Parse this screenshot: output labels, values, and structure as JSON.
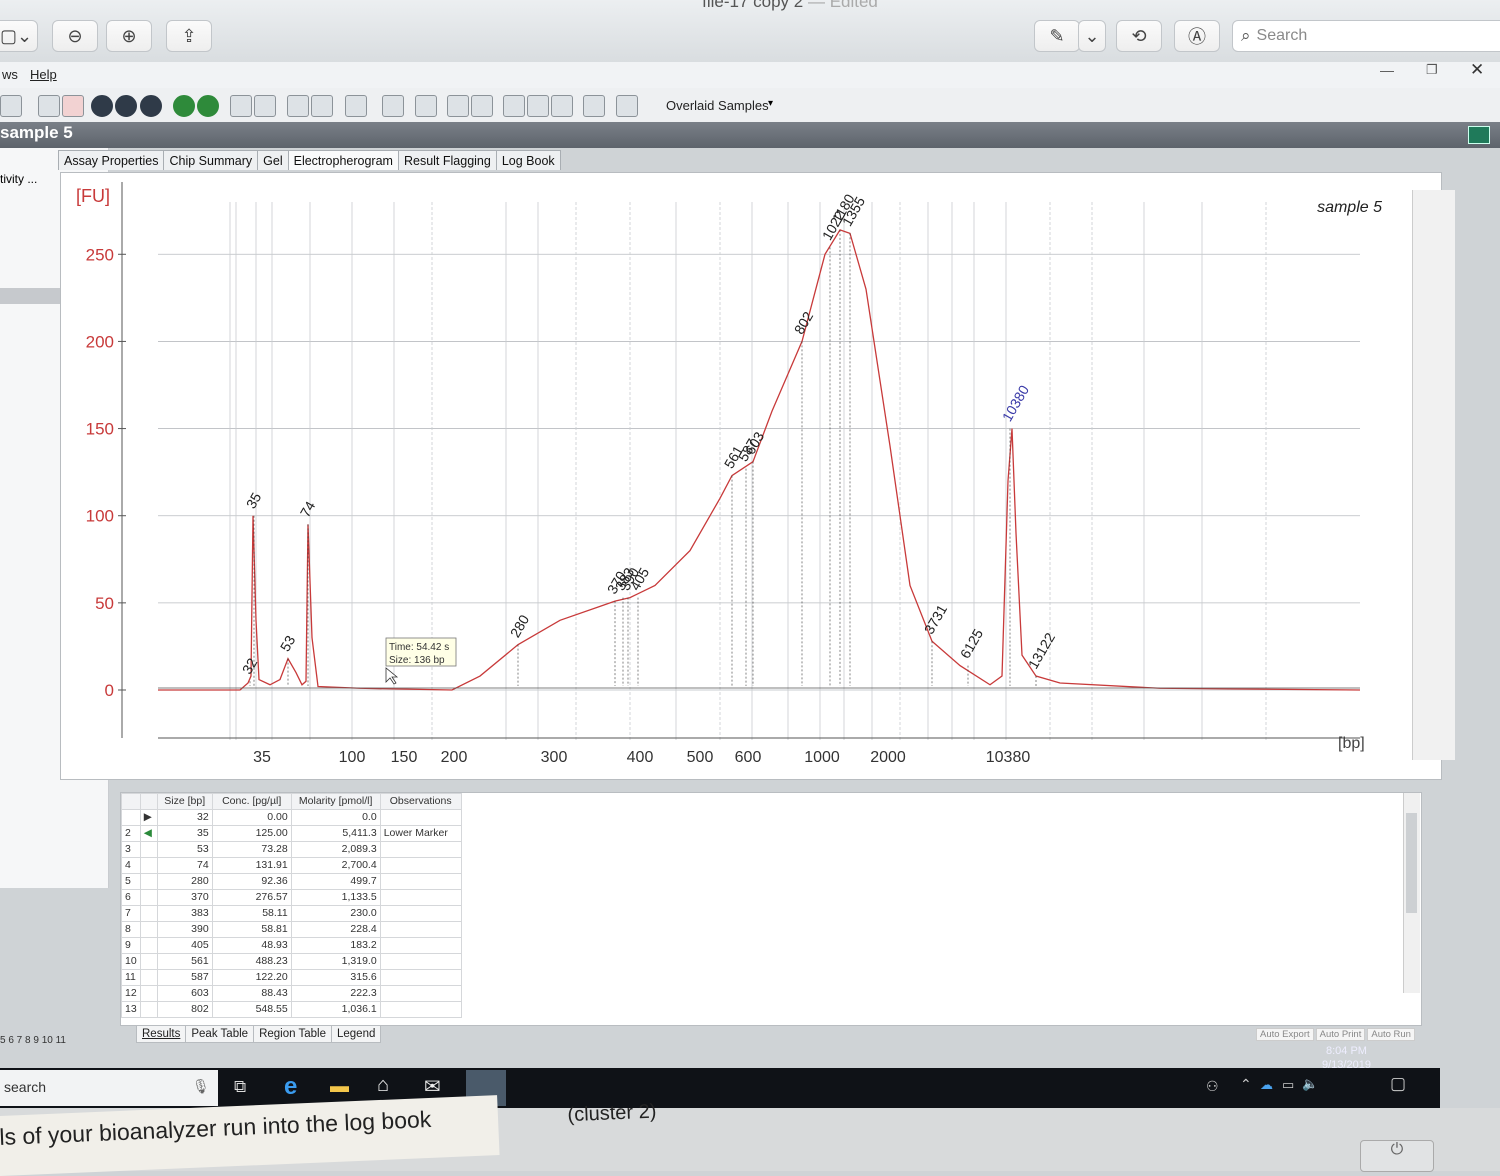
{
  "mac": {
    "title": "file-17 copy 2",
    "title_sep": " — ",
    "edited": "Edited",
    "search_placeholder": "Search"
  },
  "menu": {
    "items": [
      "ws",
      "Help"
    ]
  },
  "toolbar": {
    "overlaid_label": "Overlaid Samples"
  },
  "sample_bar": {
    "title": "sample 5"
  },
  "left_panel": {
    "label": "tivity ...",
    "pages": "5  6  7  8  9  10  11"
  },
  "tabs": [
    "Assay Properties",
    "Chip Summary",
    "Gel",
    "Electropherogram",
    "Result Flagging",
    "Log Book"
  ],
  "chart_data": {
    "type": "line",
    "title": "sample 5",
    "ylabel": "[FU]",
    "xlabel": "[bp]",
    "ylim": [
      0,
      280
    ],
    "x_ticks": [
      "35",
      "100",
      "150",
      "200",
      "300",
      "400",
      "500",
      "600",
      "1000",
      "2000",
      "10380"
    ],
    "y_ticks": [
      0,
      50,
      100,
      150,
      200,
      250
    ],
    "peak_labels": [
      "32",
      "35",
      "53",
      "74",
      "280",
      "370",
      "383",
      "390",
      "405",
      "561",
      "587",
      "603",
      "802",
      "1022",
      "1180",
      "1355",
      "3731",
      "6125",
      "10380",
      "13122"
    ],
    "peak_heights": [
      5,
      100,
      18,
      95,
      26,
      51,
      53,
      53,
      53,
      123,
      127,
      131,
      200,
      254,
      264,
      262,
      28,
      14,
      150,
      8
    ],
    "tooltip": {
      "time": "Time: 54.42 s",
      "size": "Size: 136 bp"
    },
    "grid": true,
    "series_color": "#c83a3a",
    "marker_label_color": "#3a3aa8"
  },
  "table": {
    "headers": [
      "Size [bp]",
      "Conc. [pg/µl]",
      "Molarity [pmol/l]",
      "Observations"
    ],
    "rows": [
      {
        "idx": "",
        "size": "32",
        "conc": "0.00",
        "mol": "0.0",
        "obs": ""
      },
      {
        "idx": "2",
        "size": "35",
        "conc": "125.00",
        "mol": "5,411.3",
        "obs": "Lower Marker"
      },
      {
        "idx": "3",
        "size": "53",
        "conc": "73.28",
        "mol": "2,089.3",
        "obs": ""
      },
      {
        "idx": "4",
        "size": "74",
        "conc": "131.91",
        "mol": "2,700.4",
        "obs": ""
      },
      {
        "idx": "5",
        "size": "280",
        "conc": "92.36",
        "mol": "499.7",
        "obs": ""
      },
      {
        "idx": "6",
        "size": "370",
        "conc": "276.57",
        "mol": "1,133.5",
        "obs": ""
      },
      {
        "idx": "7",
        "size": "383",
        "conc": "58.11",
        "mol": "230.0",
        "obs": ""
      },
      {
        "idx": "8",
        "size": "390",
        "conc": "58.81",
        "mol": "228.4",
        "obs": ""
      },
      {
        "idx": "9",
        "size": "405",
        "conc": "48.93",
        "mol": "183.2",
        "obs": ""
      },
      {
        "idx": "10",
        "size": "561",
        "conc": "488.23",
        "mol": "1,319.0",
        "obs": ""
      },
      {
        "idx": "11",
        "size": "587",
        "conc": "122.20",
        "mol": "315.6",
        "obs": ""
      },
      {
        "idx": "12",
        "size": "603",
        "conc": "88.43",
        "mol": "222.3",
        "obs": ""
      },
      {
        "idx": "13",
        "size": "802",
        "conc": "548.55",
        "mol": "1,036.1",
        "obs": ""
      }
    ]
  },
  "bottom_tabs": [
    "Results",
    "Peak Table",
    "Region Table",
    "Legend"
  ],
  "auto_buttons": [
    "Auto Export",
    "Auto Print",
    "Auto Run"
  ],
  "taskbar": {
    "search": "search",
    "time": "8:04 PM",
    "date": "9/13/2019"
  },
  "paper": {
    "text": "ls of your bioanalyzer run into the log book",
    "bold_part": "bioanalyzer run",
    "second_line": "(cluster 2)"
  }
}
